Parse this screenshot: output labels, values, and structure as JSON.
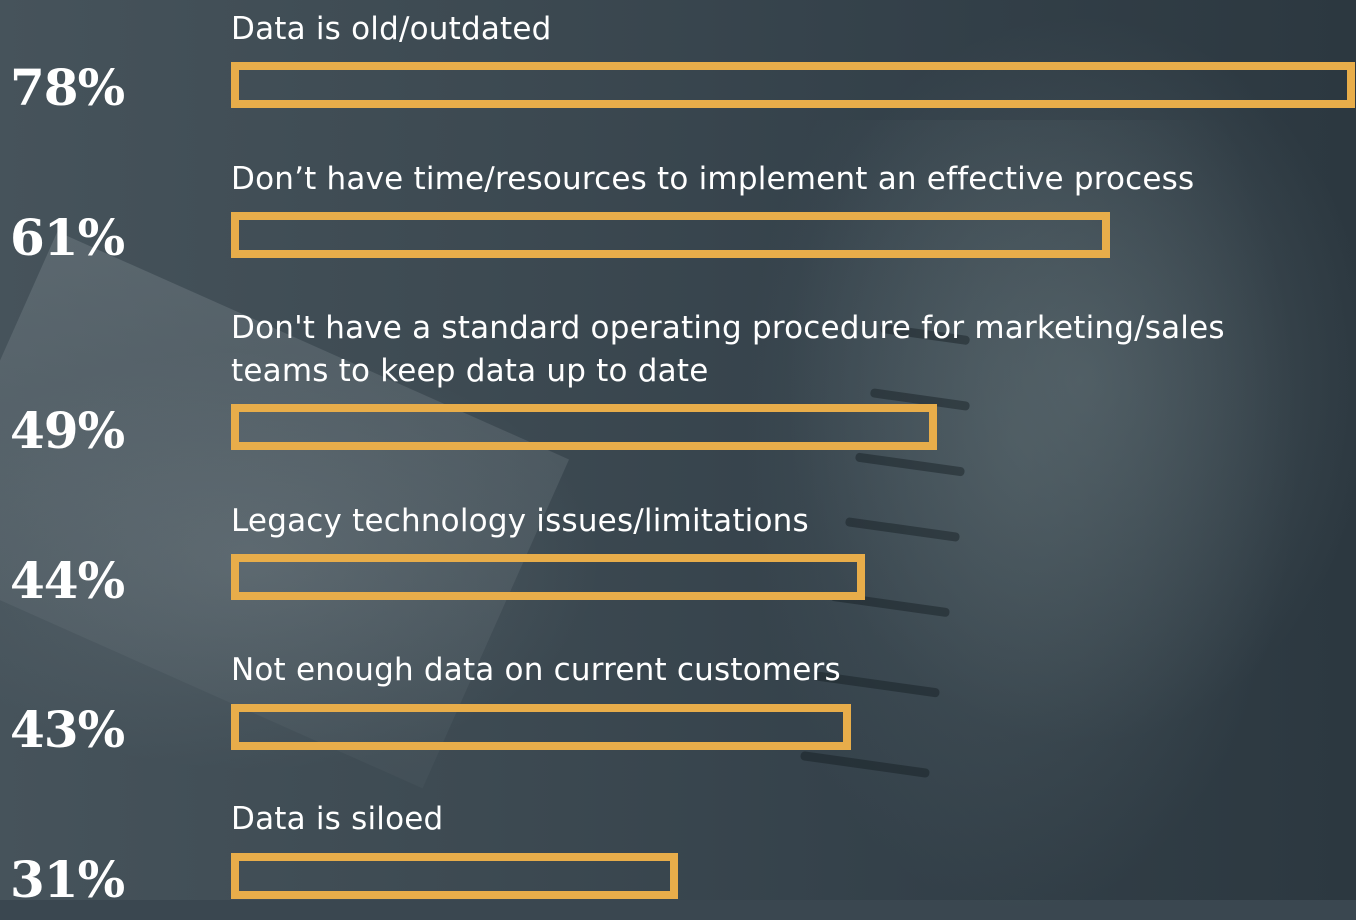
{
  "colors": {
    "bar_outline": "#e8ad4a",
    "text": "#ffffff",
    "background": "#3a4750"
  },
  "chart_data": {
    "type": "bar",
    "orientation": "horizontal",
    "categories": [
      "Data is old/outdated",
      "Don’t have time/resources to implement an effective process",
      "Don't have a standard operating procedure for marketing/sales teams to keep data up to date",
      "Legacy technology issues/limitations",
      "Not enough data on current customers",
      "Data is siloed"
    ],
    "values": [
      78,
      61,
      49,
      44,
      43,
      31
    ],
    "value_labels": [
      "78%",
      "61%",
      "49%",
      "44%",
      "43%",
      "31%"
    ],
    "unit": "%",
    "xlim": [
      0,
      78
    ],
    "grid": false,
    "legend": "none"
  }
}
